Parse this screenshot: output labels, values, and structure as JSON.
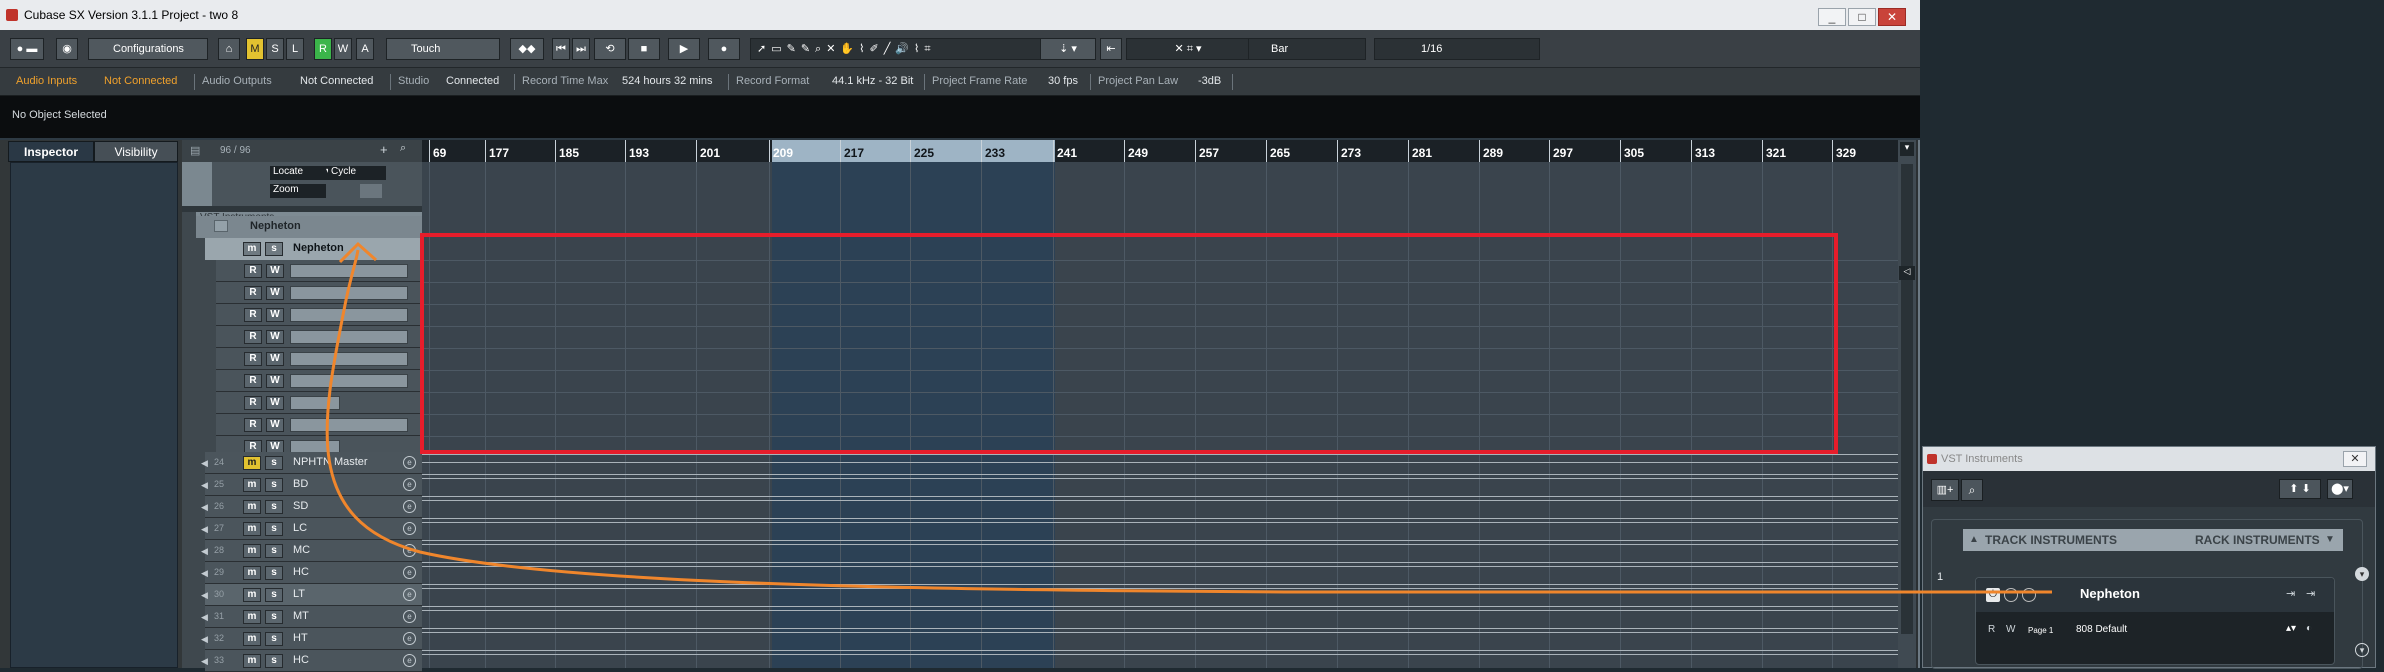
{
  "window": {
    "title": "Cubase SX Version 3.1.1 Project - two 8"
  },
  "toolbar": {
    "configurations": "Configurations",
    "m": "M",
    "s": "S",
    "l": "L",
    "r": "R",
    "w": "W",
    "a": "A",
    "automation_mode": "Touch",
    "snap_type": "Bar",
    "quantize": "1/16"
  },
  "status": {
    "audio_inputs_label": "Audio Inputs",
    "audio_inputs_value": "Not Connected",
    "audio_outputs_label": "Audio Outputs",
    "audio_outputs_value": "Not Connected",
    "studio_label": "Studio",
    "studio_value": "Connected",
    "record_time_label": "Record Time Max",
    "record_time_value": "524 hours 32 mins",
    "record_format_label": "Record Format",
    "record_format_value": "44.1 kHz - 32 Bit",
    "frame_rate_label": "Project Frame Rate",
    "frame_rate_value": "30 fps",
    "pan_law_label": "Project Pan Law",
    "pan_law_value": "-3dB"
  },
  "infoline": {
    "text": "No Object Selected"
  },
  "inspector": {
    "tab_inspector": "Inspector",
    "tab_visibility": "Visibility"
  },
  "tracklist": {
    "count": "96 / 96",
    "locate": "Locate",
    "cycle": "Cycle",
    "zoom": "Zoom",
    "folder": "VST Instruments",
    "instrument_folder": "Nepheton",
    "selected_track": "Nepheton",
    "tracks": [
      {
        "num": "24",
        "name": "NPHTN Master"
      },
      {
        "num": "25",
        "name": "BD"
      },
      {
        "num": "26",
        "name": "SD"
      },
      {
        "num": "27",
        "name": "LC"
      },
      {
        "num": "28",
        "name": "MC"
      },
      {
        "num": "29",
        "name": "HC"
      },
      {
        "num": "30",
        "name": "LT"
      },
      {
        "num": "31",
        "name": "MT"
      },
      {
        "num": "32",
        "name": "HT"
      },
      {
        "num": "33",
        "name": "HC"
      }
    ]
  },
  "ruler": {
    "ticks": [
      "69",
      "177",
      "185",
      "193",
      "201",
      "209",
      "217",
      "225",
      "233",
      "241",
      "249",
      "257",
      "265",
      "273",
      "281",
      "289",
      "297",
      "305",
      "313",
      "321",
      "329"
    ]
  },
  "vst_panel": {
    "title": "VST Instruments",
    "track_instruments": "TRACK INSTRUMENTS",
    "rack_instruments": "RACK INSTRUMENTS",
    "slot_number": "1",
    "instrument": "Nepheton",
    "page": "Page 1",
    "preset": "808 Default"
  },
  "colors": {
    "annotation_box": "#e71d2b",
    "annotation_arrow": "#f0862c",
    "accent_orange": "#f0a12c"
  }
}
